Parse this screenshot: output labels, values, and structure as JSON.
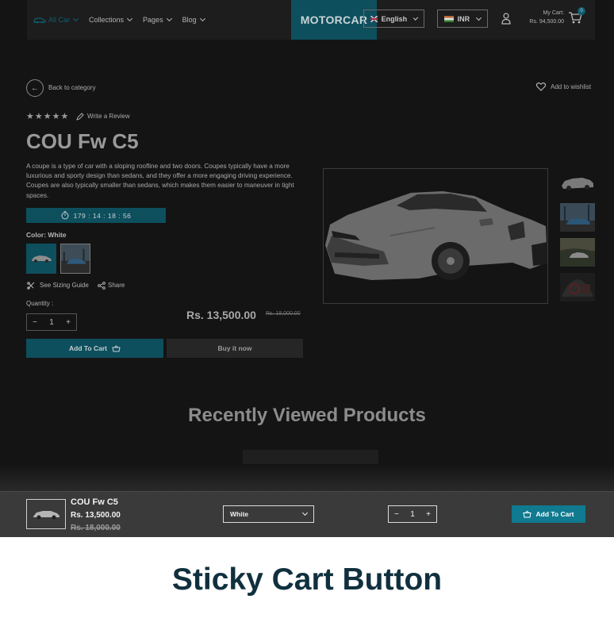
{
  "header": {
    "nav": [
      {
        "label": "All Car",
        "active": true
      },
      {
        "label": "Collections"
      },
      {
        "label": "Pages"
      },
      {
        "label": "Blog"
      }
    ],
    "logo": "MOTORCAR",
    "language": "English",
    "currency": "INR",
    "cart_label": "My Cart:",
    "cart_total": "Rs. 94,500.00",
    "cart_count": "0"
  },
  "product": {
    "back_label": "Back to category",
    "wishlist_label": "Add to wishlist",
    "rating": 5,
    "review_label": "Write a Review",
    "title": "COU Fw C5",
    "description": "A coupe is a type of car with a sloping roofline and two doors. Coupes typically have a more luxurious and sporty design than sedans, and they offer a more engaging driving experience. Coupes are also typically smaller than sedans, which makes them easier to maneuver in tight spaces.",
    "timer": "179 : 14 : 18 : 56",
    "color_label": "Color: White",
    "sizing_label": "See Sizing Guide",
    "share_label": "Share",
    "quantity_label": "Quantity :",
    "quantity": "1",
    "price": "Rs. 13,500.00",
    "old_price": "Rs. 18,000.00",
    "add_to_cart": "Add To Cart",
    "buy_now": "Buy it now"
  },
  "recent": {
    "title": "Recently Viewed Products"
  },
  "sticky": {
    "name": "COU Fw C5",
    "price": "Rs. 13,500.00",
    "old_price": "Rs. 18,000.00",
    "variant": "White",
    "quantity": "1",
    "add_to_cart": "Add To Cart"
  },
  "caption": "Sticky Cart Button",
  "colors": {
    "accent": "#0e4f5e",
    "sticky_button": "#0f7a90",
    "caption_text": "#10303e"
  },
  "icons": [
    "car-icon",
    "user-icon",
    "cart-icon",
    "arrow-left-icon",
    "heart-icon",
    "star-icon",
    "pencil-icon",
    "stopwatch-icon",
    "ruler-icon",
    "share-icon",
    "basket-icon",
    "chevron-down-icon"
  ]
}
